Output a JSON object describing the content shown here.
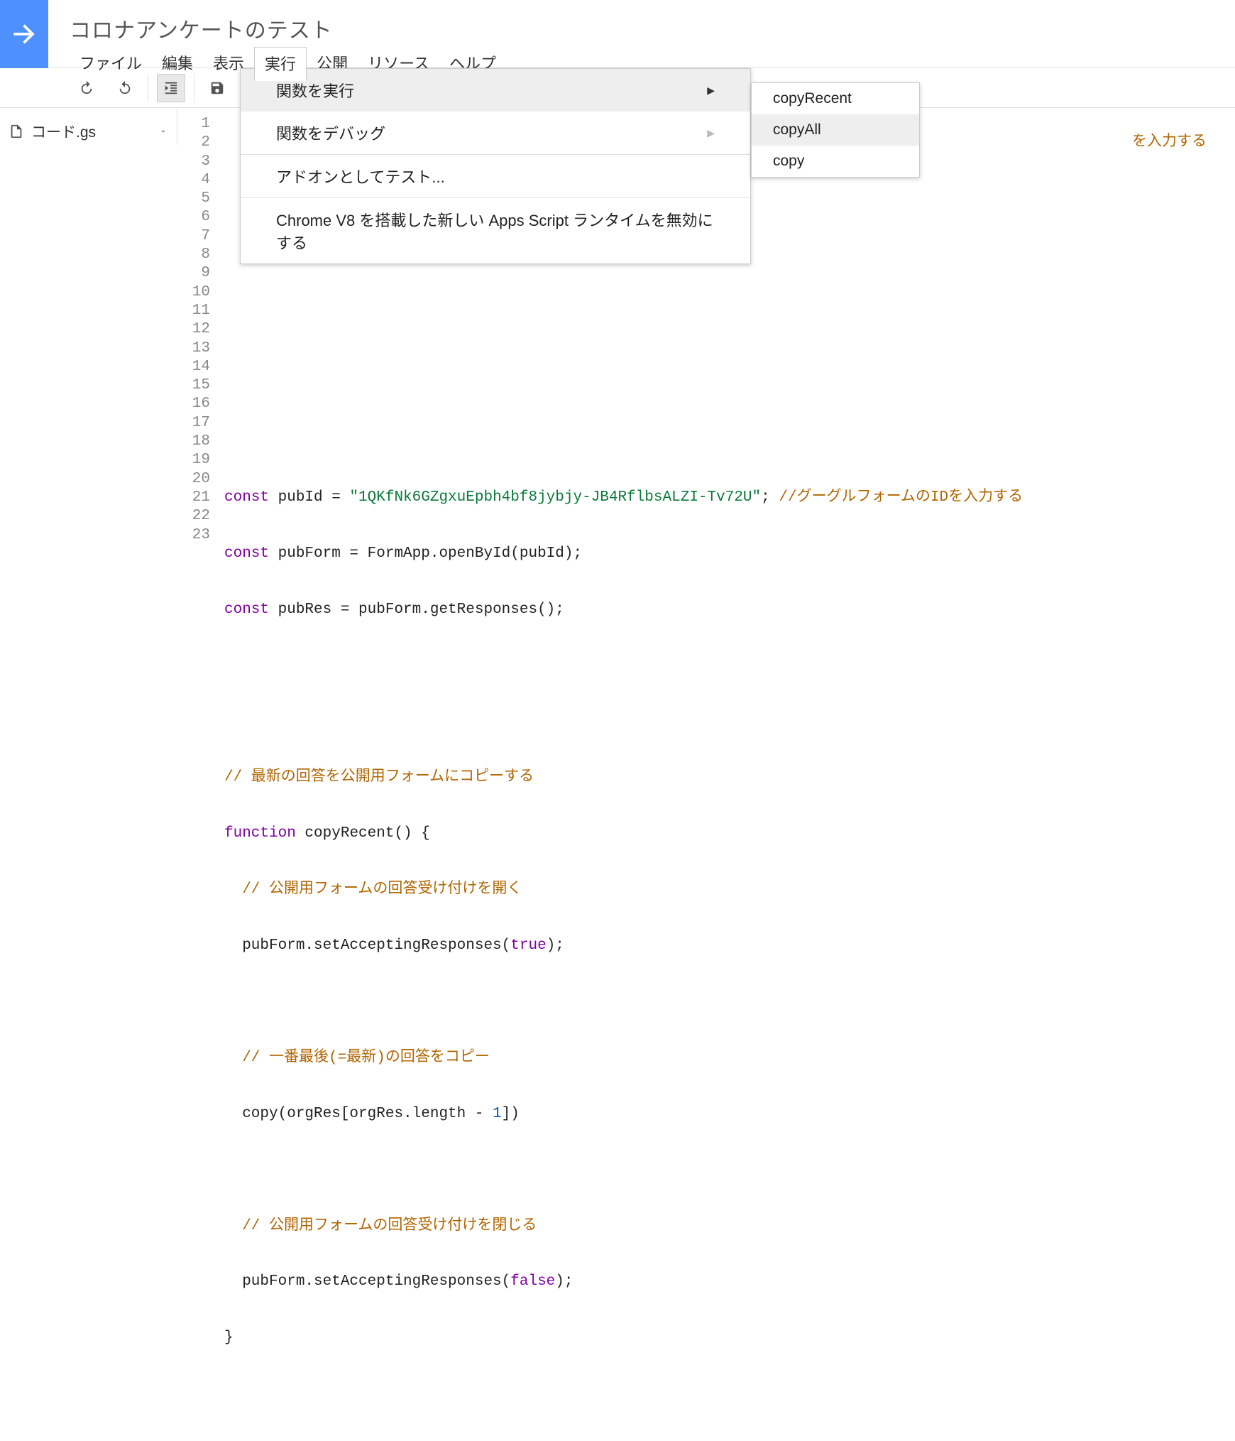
{
  "project_title": "コロナアンケートのテスト",
  "menubar": {
    "file": "ファイル",
    "edit": "編集",
    "view": "表示",
    "run": "実行",
    "publish": "公開",
    "resources": "リソース",
    "help": "ヘルプ"
  },
  "sidebar": {
    "file_name": "コード.gs"
  },
  "dropdown": {
    "run_function": "関数を実行",
    "debug_function": "関数をデバッグ",
    "test_as_addon": "アドオンとしてテスト...",
    "disable_v8": "Chrome V8 を搭載した新しい Apps Script ランタイムを無効にする"
  },
  "submenu": {
    "copyRecent": "copyRecent",
    "copyAll": "copyAll",
    "copy": "copy"
  },
  "code": {
    "line_numbers": [
      "1",
      "2",
      "3",
      "4",
      "5",
      "6",
      "7",
      "8",
      "9",
      "10",
      "11",
      "12",
      "13",
      "14",
      "15",
      "16",
      "17",
      "18",
      "19",
      "20",
      "21",
      "22",
      "23"
    ],
    "trailing_comment_l2": "を入力する",
    "l7": {
      "kw": "const",
      "var": " pubId = ",
      "str": "\"1QKfNk6GZgxuEpbh4bf8jybjy-JB4RflbsALZI-Tv72U\"",
      "semi": "; ",
      "cmt": "//グーグルフォームのIDを入力する"
    },
    "l8": {
      "kw": "const",
      "rest": " pubForm = FormApp.openById(pubId);"
    },
    "l9": {
      "kw": "const",
      "rest": " pubRes = pubForm.getResponses();"
    },
    "l12": "// 最新の回答を公開用フォームにコピーする",
    "l13": {
      "kw": "function",
      "rest": " copyRecent() {"
    },
    "l14": "  // 公開用フォームの回答受け付けを開く",
    "l15": {
      "pre": "  pubForm.setAcceptingResponses(",
      "bool": "true",
      "post": ");"
    },
    "l17": "  // 一番最後(=最新)の回答をコピー",
    "l18": {
      "pre": "  copy(orgRes[orgRes.length - ",
      "num": "1",
      "post": "])"
    },
    "l20": "  // 公開用フォームの回答受け付けを閉じる",
    "l21": {
      "pre": "  pubForm.setAcceptingResponses(",
      "bool": "false",
      "post": ");"
    },
    "l22": "}"
  }
}
